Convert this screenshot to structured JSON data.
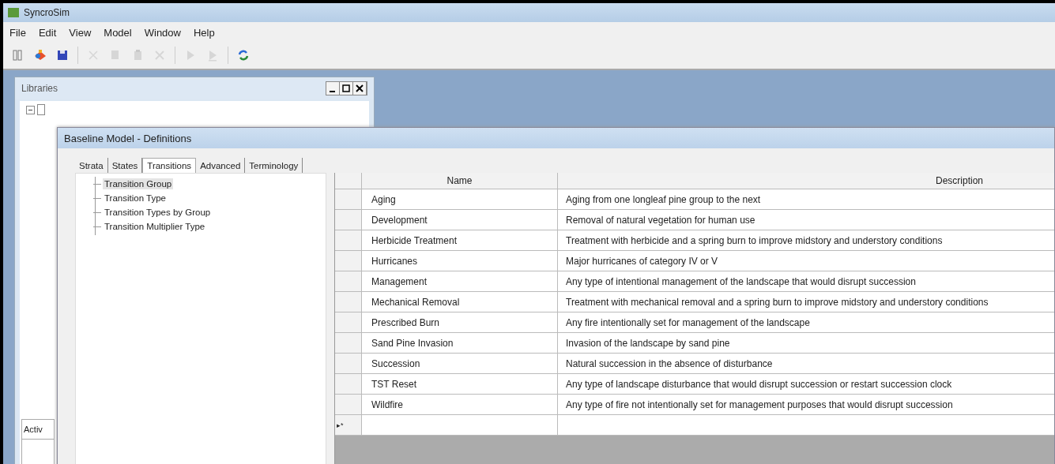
{
  "window": {
    "title": "SyncroSim"
  },
  "menu": [
    "File",
    "Edit",
    "View",
    "Model",
    "Window",
    "Help"
  ],
  "toolbar": [
    {
      "kind": "library",
      "disabled": false
    },
    {
      "kind": "open",
      "disabled": false
    },
    {
      "kind": "save",
      "disabled": false
    },
    {
      "kind": "separator"
    },
    {
      "kind": "cut",
      "disabled": true
    },
    {
      "kind": "copy",
      "disabled": true
    },
    {
      "kind": "paste",
      "disabled": true
    },
    {
      "kind": "delete",
      "disabled": true
    },
    {
      "kind": "separator"
    },
    {
      "kind": "run",
      "disabled": true
    },
    {
      "kind": "run-step",
      "disabled": true
    },
    {
      "kind": "separator"
    },
    {
      "kind": "refresh",
      "disabled": false
    }
  ],
  "libraries_panel": {
    "title": "Libraries",
    "activity_tab": "Activ"
  },
  "definitions_window": {
    "title": "Baseline Model - Definitions",
    "tabs": [
      {
        "label": "Strata",
        "selected": false
      },
      {
        "label": "States",
        "selected": false
      },
      {
        "label": "Transitions",
        "selected": true
      },
      {
        "label": "Advanced",
        "selected": false
      },
      {
        "label": "Terminology",
        "selected": false
      }
    ],
    "tree": [
      {
        "label": "Transition Group",
        "selected": true
      },
      {
        "label": "Transition Type",
        "selected": false
      },
      {
        "label": "Transition Types by Group",
        "selected": false
      },
      {
        "label": "Transition Multiplier Type",
        "selected": false
      }
    ],
    "table": {
      "columns": [
        "Name",
        "Description"
      ],
      "rows": [
        [
          "Aging",
          "Aging from one longleaf pine group to the next"
        ],
        [
          "Development",
          "Removal of natural vegetation for human use"
        ],
        [
          "Herbicide Treatment",
          "Treatment with herbicide and a spring burn to improve midstory and understory conditions"
        ],
        [
          "Hurricanes",
          "Major hurricanes of category IV or V"
        ],
        [
          "Management",
          "Any type of intentional management of the landscape that would disrupt succession"
        ],
        [
          "Mechanical Removal",
          "Treatment with mechanical removal and a spring burn to improve midstory and understory conditions"
        ],
        [
          "Prescribed Burn",
          "Any fire intentionally set for management of the landscape"
        ],
        [
          "Sand Pine Invasion",
          "Invasion of the landscape by sand pine"
        ],
        [
          "Succession",
          "Natural succession in the absence of disturbance"
        ],
        [
          "TST Reset",
          "Any type of landscape disturbance that would disrupt succession or restart succession clock"
        ],
        [
          "Wildfire",
          "Any type of fire not intentionally set for management purposes that would disrupt succession"
        ]
      ],
      "new_row_marker": "▸*"
    }
  }
}
